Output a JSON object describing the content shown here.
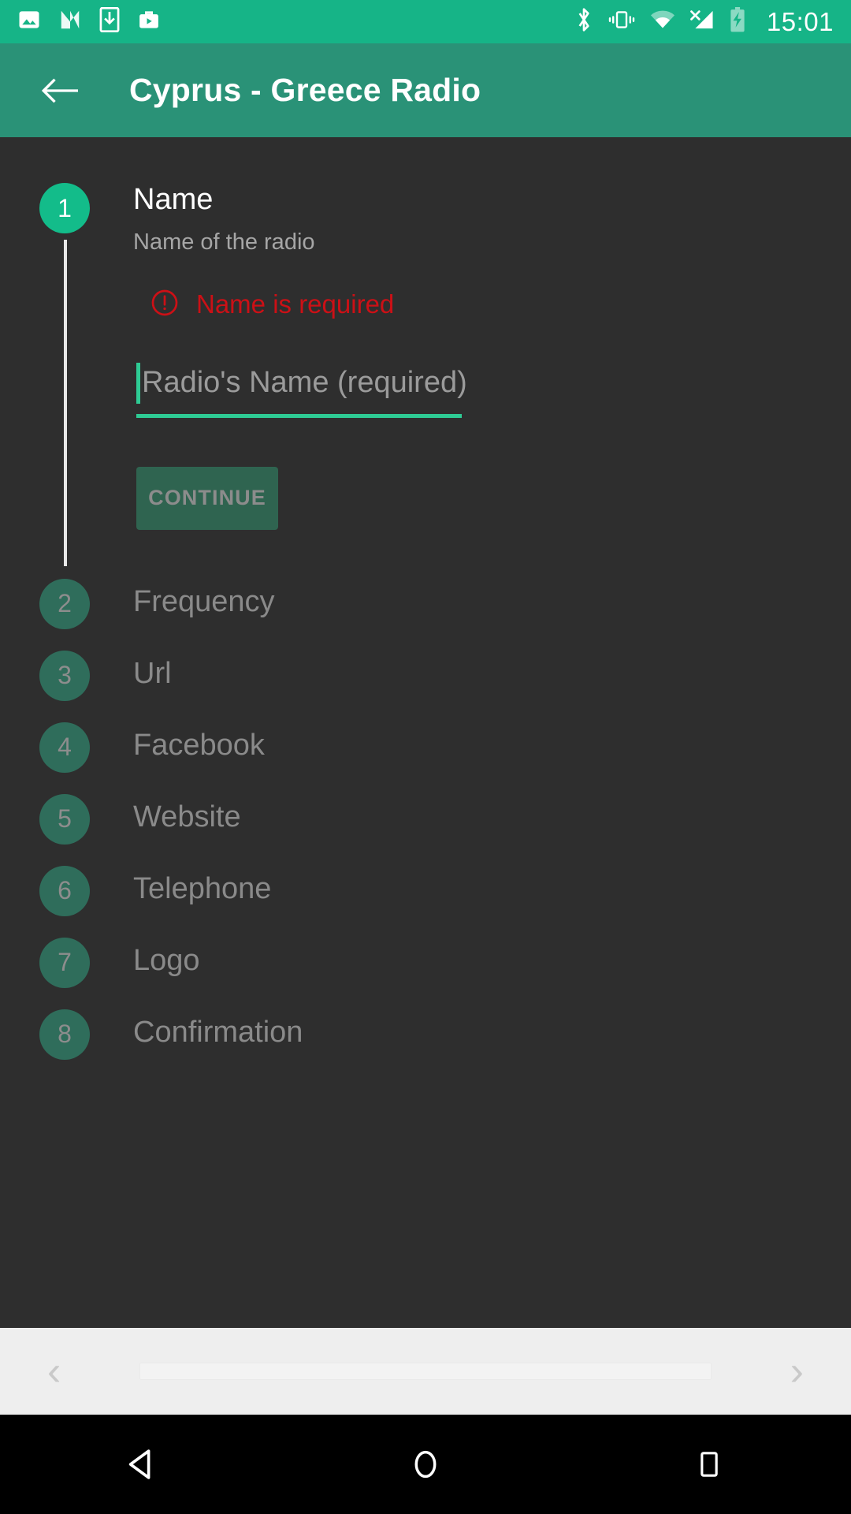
{
  "status_bar": {
    "time": "15:01",
    "left_icons": [
      "image-icon",
      "android-n-icon",
      "download-icon",
      "play-store-briefcase-icon"
    ],
    "right_icons": [
      "bluetooth-icon",
      "vibrate-icon",
      "wifi-icon",
      "no-signal-icon",
      "battery-charging-icon"
    ],
    "background_color": "#16b487"
  },
  "toolbar": {
    "back_label": "←",
    "title": "Cyprus - Greece Radio",
    "background_color": "#2a9277"
  },
  "stepper": {
    "active_circle_color": "#13bc8a",
    "inactive_circle_color": "#2f6d5b",
    "steps": [
      {
        "number": "1",
        "title": "Name",
        "subtitle": "Name of the radio",
        "state": "active",
        "error_text": "Name is required",
        "error_color": "#cc1016",
        "input_placeholder": "Radio's Name (required)",
        "input_value": "",
        "button_label": "CONTINUE"
      },
      {
        "number": "2",
        "title": "Frequency",
        "state": "inactive"
      },
      {
        "number": "3",
        "title": "Url",
        "state": "inactive"
      },
      {
        "number": "4",
        "title": "Facebook",
        "state": "inactive"
      },
      {
        "number": "5",
        "title": "Website",
        "state": "inactive"
      },
      {
        "number": "6",
        "title": "Telephone",
        "state": "inactive"
      },
      {
        "number": "7",
        "title": "Logo",
        "state": "inactive"
      },
      {
        "number": "8",
        "title": "Confirmation",
        "state": "inactive"
      }
    ]
  },
  "bottom_bar": {
    "prev_label": "‹",
    "next_label": "›",
    "background_color": "#eeeeee"
  },
  "nav_bar": {
    "back_icon": "triangle-back-icon",
    "home_icon": "circle-home-icon",
    "recents_icon": "square-recents-icon",
    "background_color": "#000000"
  }
}
